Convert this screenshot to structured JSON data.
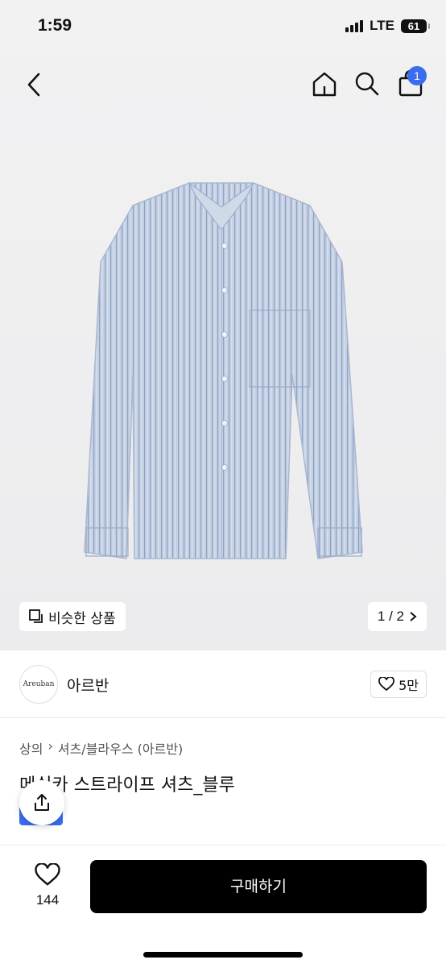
{
  "status": {
    "time": "1:59",
    "network": "LTE",
    "battery": "61"
  },
  "nav": {
    "cart_count": "1"
  },
  "gallery": {
    "similar_label": "비슷한 상품",
    "pager": "1 / 2"
  },
  "brand": {
    "logo_text": "Areuban",
    "name": "아르반",
    "likes": "5만"
  },
  "product": {
    "breadcrumb": [
      "상의",
      "셔츠/블라우스 (아르반)"
    ],
    "title": "메쉬카 스트라이프 셔츠_블루"
  },
  "bottom": {
    "like_count": "144",
    "buy_label": "구매하기"
  },
  "colors": {
    "accent": "#3b6cf0",
    "shirt": "#b9c6dc",
    "buy_bg": "#000000"
  }
}
